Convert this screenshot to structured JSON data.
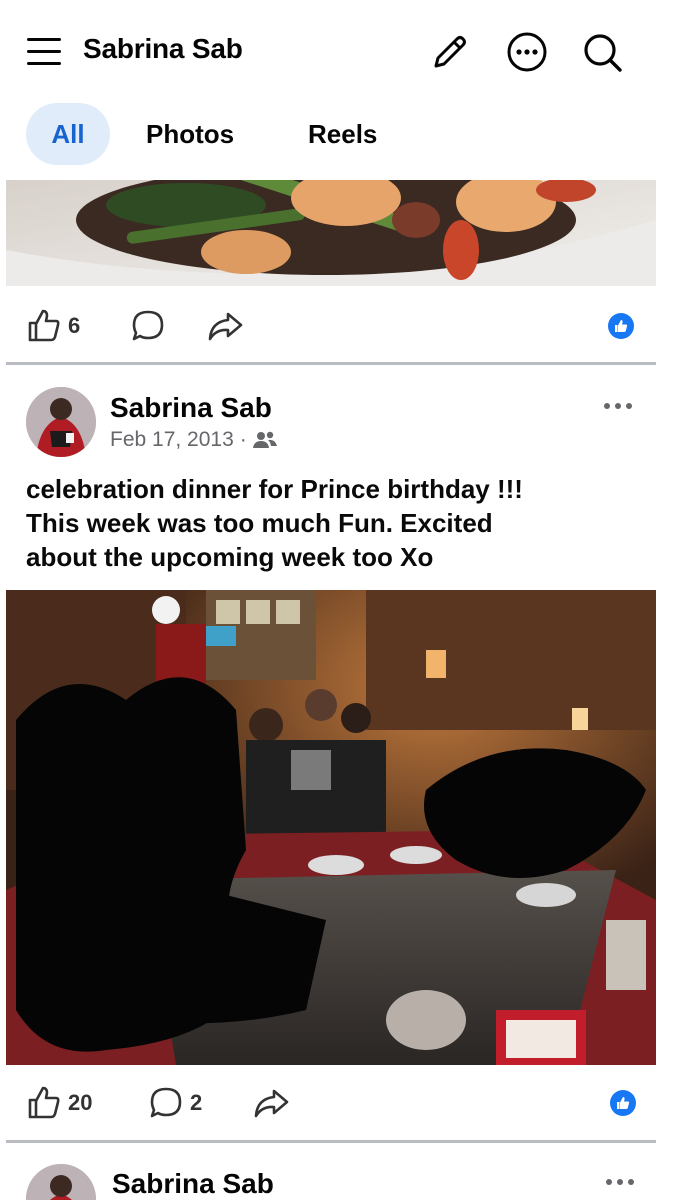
{
  "header": {
    "page_name": "Sabrina Sab",
    "icons": [
      "menu-icon",
      "edit-icon",
      "more-icon",
      "search-icon"
    ]
  },
  "tabs": [
    {
      "label": "All",
      "active": true
    },
    {
      "label": "Photos",
      "active": false
    },
    {
      "label": "Reels",
      "active": false
    }
  ],
  "posts": [
    {
      "photo": "food-photo",
      "reactions": {
        "likes": "6"
      }
    },
    {
      "author": "Sabrina Sab",
      "date": "Feb 17, 2013",
      "separator": "·",
      "audience_icon": "friends-icon",
      "text_lines": [
        "celebration  dinner for Prince birthday !!!",
        "This week was too much Fun. Excited",
        "about the upcoming week too Xo"
      ],
      "photo": "restaurant-photo",
      "reactions": {
        "likes": "20",
        "comments": "2"
      }
    },
    {
      "author": "Sabrina Sab"
    }
  ],
  "colors": {
    "accent": "#1877f2",
    "active_tab_bg": "#e1ecfb",
    "active_tab_text": "#1763cf",
    "meta_text": "#65676b"
  }
}
